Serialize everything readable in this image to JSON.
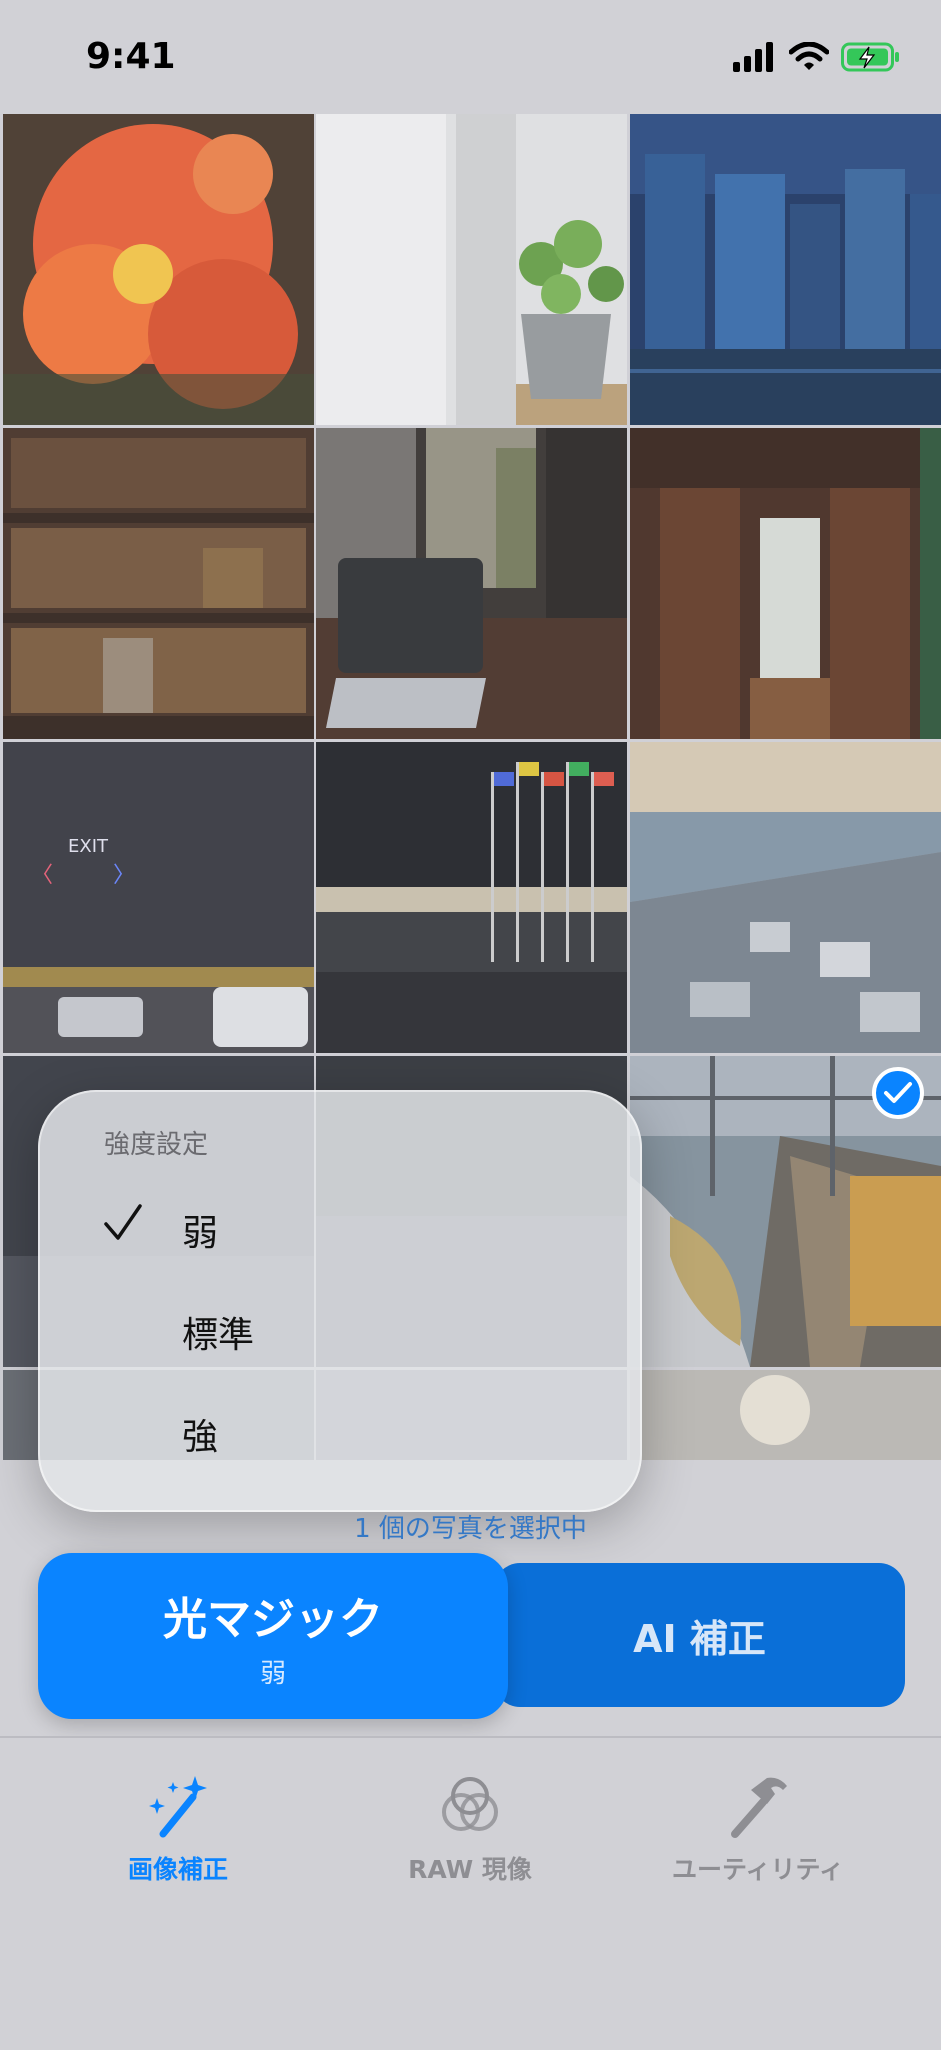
{
  "status_bar": {
    "time": "9:41"
  },
  "grid": {
    "photos": [
      {
        "subject": "red clivia flowers"
      },
      {
        "subject": "potted plant by window"
      },
      {
        "subject": "city skyscrapers at dusk"
      },
      {
        "subject": "bookshelf"
      },
      {
        "subject": "laptop on desk"
      },
      {
        "subject": "wooden hallway"
      },
      {
        "subject": "night street with flags"
      },
      {
        "subject": "flagpoles at night"
      },
      {
        "subject": "aerial coastal city"
      },
      {
        "subject": "night photo"
      },
      {
        "subject": "night photo"
      },
      {
        "subject": "railway station with train",
        "selected": true
      }
    ]
  },
  "strength_menu": {
    "title": "強度設定",
    "options": [
      {
        "label": "弱",
        "checked": true
      },
      {
        "label": "標準",
        "checked": false
      },
      {
        "label": "強",
        "checked": false
      }
    ]
  },
  "selection": {
    "text": "1 個の写真を選択中"
  },
  "actions": {
    "magic": {
      "label": "光マジック",
      "sublabel": "弱"
    },
    "ai": {
      "label": "AI 補正"
    }
  },
  "tabbar": {
    "tabs": [
      {
        "label": "画像補正",
        "icon": "magic-wand-icon",
        "active": true
      },
      {
        "label": "RAW 現像",
        "icon": "circles-icon",
        "active": false
      },
      {
        "label": "ユーティリティ",
        "icon": "hammer-icon",
        "active": false
      }
    ]
  },
  "colors": {
    "accent": "#0a84ff",
    "battery": "#34c759"
  }
}
